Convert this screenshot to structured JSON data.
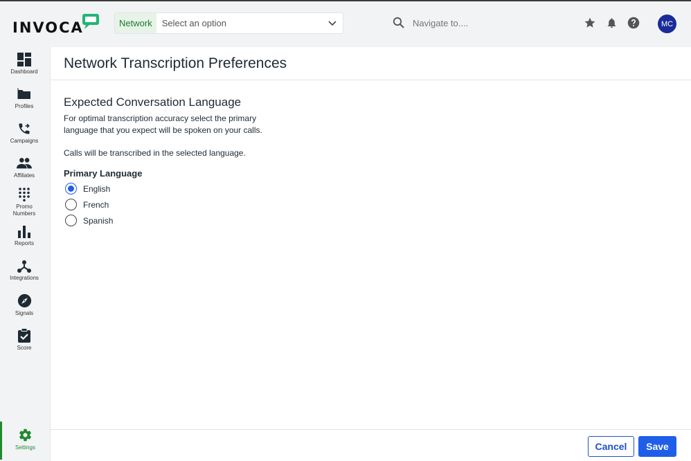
{
  "app": {
    "logo_text": "INVOCA",
    "network_label": "Network",
    "network_select_value": "Select an option",
    "navigate_placeholder": "Navigate to....",
    "avatar_initials": "MC"
  },
  "sidebar": {
    "items": [
      {
        "label": "Dashboard",
        "icon": "dashboard-icon"
      },
      {
        "label": "Profiles",
        "icon": "folder-icon"
      },
      {
        "label": "Campaigns",
        "icon": "phone-forward-icon"
      },
      {
        "label": "Affiliates",
        "icon": "people-icon"
      },
      {
        "label": "Promo Numbers",
        "icon": "dialpad-icon"
      },
      {
        "label": "Reports",
        "icon": "bar-chart-icon"
      },
      {
        "label": "Integrations",
        "icon": "hub-icon"
      },
      {
        "label": "Signals",
        "icon": "compass-icon"
      },
      {
        "label": "Score",
        "icon": "clipboard-check-icon"
      }
    ],
    "settings_label": "Settings"
  },
  "page": {
    "title": "Network Transcription Preferences",
    "section_title": "Expected Conversation Language",
    "description": "For optimal transcription accuracy select the primary language that you expect will be spoken on your calls.",
    "note": "Calls will be transcribed in the selected language.",
    "field_label": "Primary Language",
    "options": [
      {
        "label": "English",
        "selected": true
      },
      {
        "label": "French",
        "selected": false
      },
      {
        "label": "Spanish",
        "selected": false
      }
    ]
  },
  "footer": {
    "cancel_label": "Cancel",
    "save_label": "Save"
  },
  "colors": {
    "accent_blue": "#1f5ee8",
    "network_green": "#1f7a2c",
    "settings_green": "#1f8a2e",
    "logo_bubble": "#22b573",
    "avatar_bg": "#1a2c9a"
  }
}
